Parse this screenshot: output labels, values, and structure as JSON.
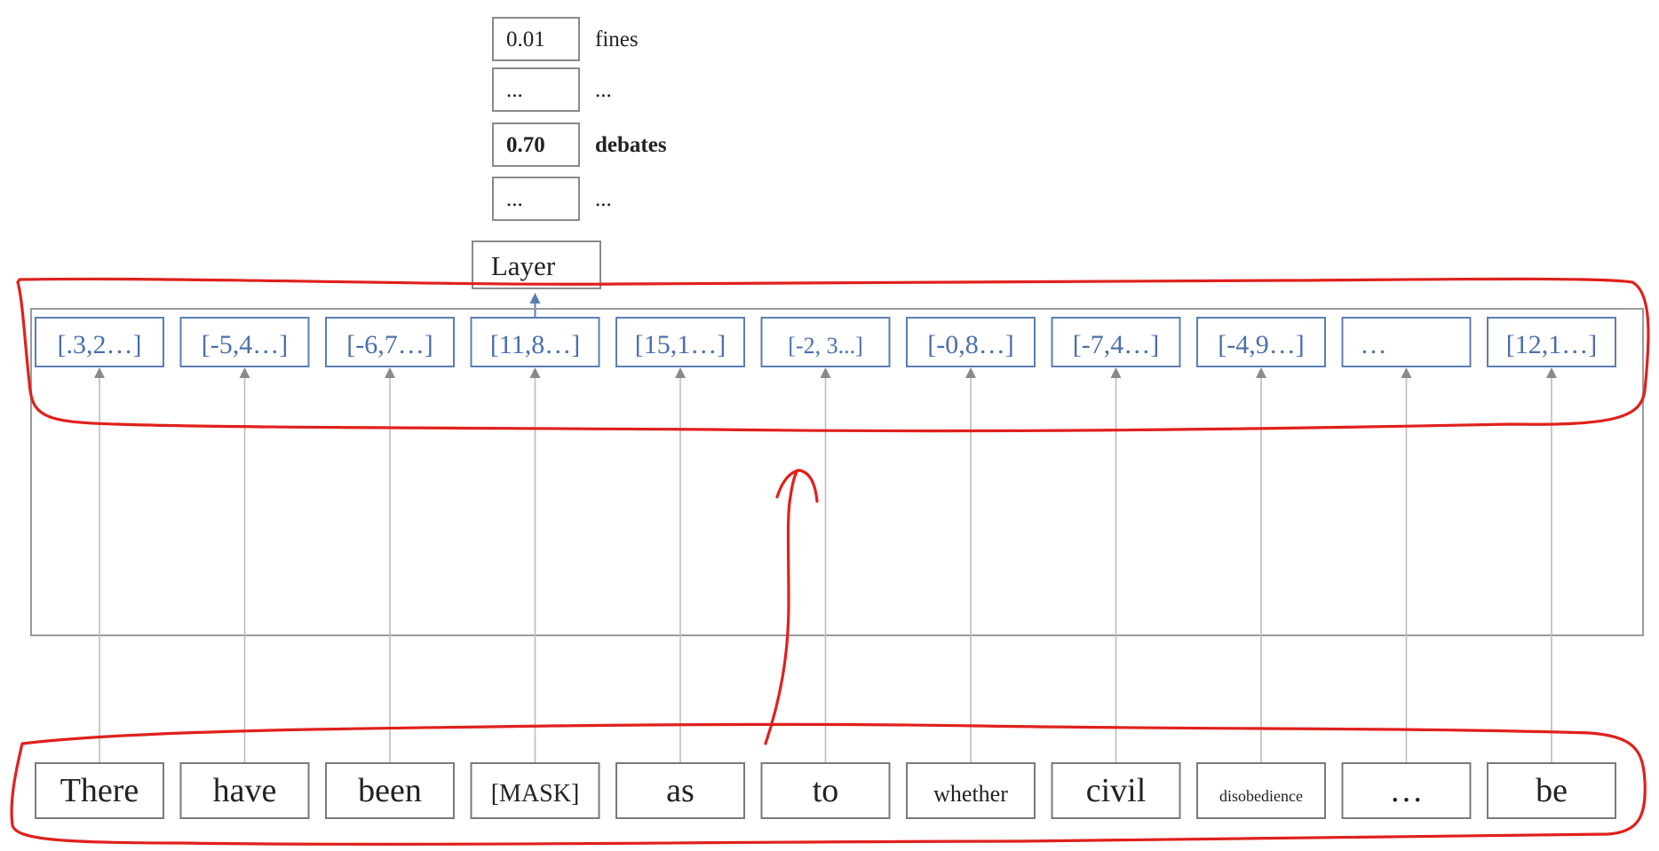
{
  "output_probabilities": [
    {
      "value": "0.01",
      "word": "fines",
      "bold": false
    },
    {
      "value": "...",
      "word": "...",
      "bold": false
    },
    {
      "value": "0.70",
      "word": "debates",
      "bold": true
    },
    {
      "value": "...",
      "word": "...",
      "bold": false
    }
  ],
  "layer_label": "Layer",
  "embeddings": [
    "[.3,2…]",
    "[-5,4…]",
    "[-6,7…]",
    "[11,8…]",
    "[15,1…]",
    "[-2, 3...]",
    "[-0,8…]",
    "[-7,4…]",
    "[-4,9…]",
    "…",
    "[12,1…]"
  ],
  "tokens": [
    "There",
    "have",
    "been",
    "[MASK]",
    "as",
    "to",
    "whether",
    "civil",
    "disobedience",
    "…",
    "be"
  ],
  "colors": {
    "vector_text": "#4a6fad",
    "vector_border": "#5b7db5",
    "annotation": "#e0201c",
    "box_border": "#8a8a8a"
  }
}
